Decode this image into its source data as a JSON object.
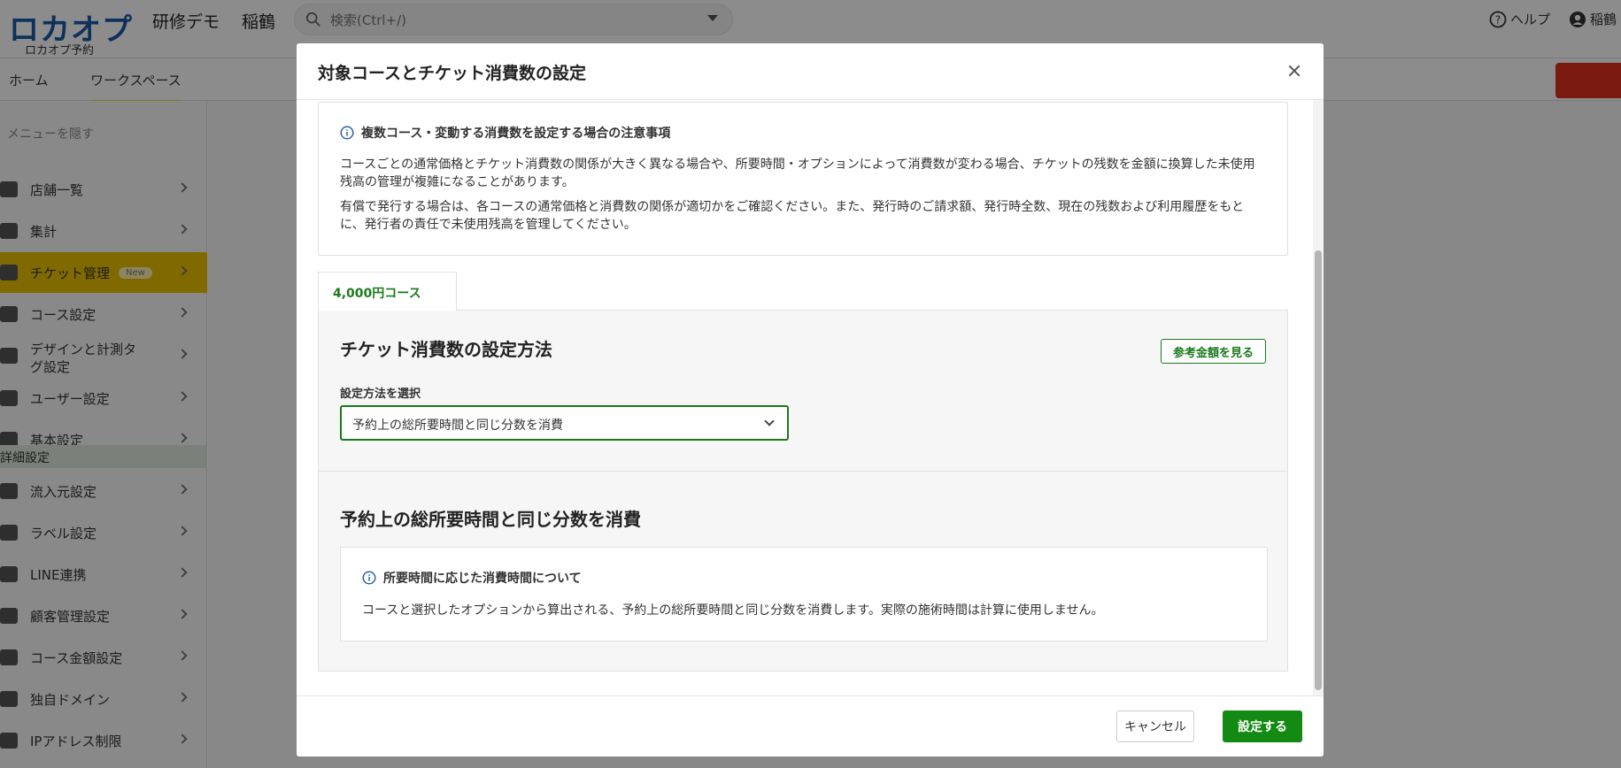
{
  "app": {
    "logo_text": "ロカオプ",
    "logo_sub": "ロカオプ予約",
    "org_name": "研修デモ",
    "user_short": "稲鶴",
    "search_placeholder": "検索(Ctrl+/)",
    "help_label": "ヘルプ",
    "account_label": "稲鶴"
  },
  "nav": {
    "items": [
      {
        "label": "ホーム"
      },
      {
        "label": "ワークスペース"
      }
    ]
  },
  "sidebar": {
    "hide_label": "メニューを隠す",
    "items": [
      {
        "label": "店舗一覧"
      },
      {
        "label": "集計"
      },
      {
        "label": "チケット管理",
        "badge": "New"
      },
      {
        "label": "コース設定"
      },
      {
        "label": "デザインと計測タグ設定"
      },
      {
        "label": "ユーザー設定"
      },
      {
        "label": "基本設定"
      },
      {
        "label": "流入元設定"
      },
      {
        "label": "ラベル設定"
      },
      {
        "label": "LINE連携"
      },
      {
        "label": "顧客管理設定"
      },
      {
        "label": "コース金額設定"
      },
      {
        "label": "独自ドメイン"
      },
      {
        "label": "IPアドレス制限"
      }
    ],
    "section_label": "詳細設定"
  },
  "modal": {
    "title": "対象コースとチケット消費数の設定",
    "notice": {
      "title": "複数コース・変動する消費数を設定する場合の注意事項",
      "paragraph1": "コースごとの通常価格とチケット消費数の関係が大きく異なる場合や、所要時間・オプションによって消費数が変わる場合、チケットの残数を金額に換算した未使用残高の管理が複雑になることがあります。",
      "paragraph2": "有償で発行する場合は、各コースの通常価格と消費数の関係が適切かをご確認ください。また、発行時のご請求額、発行時全数、現在の残数および利用履歴をもとに、発行者の責任で未使用残高を管理してください。"
    },
    "tab_label": "4,000円コース",
    "section1": {
      "title": "チケット消費数の設定方法",
      "ref_button": "参考金額を見る",
      "method_label": "設定方法を選択",
      "method_value": "予約上の総所要時間と同じ分数を消費"
    },
    "section2": {
      "title": "予約上の総所要時間と同じ分数を消費",
      "note_title": "所要時間に応じた消費時間について",
      "note_body": "コースと選択したオプションから算出される、予約上の総所要時間と同じ分数を消費します。実際の施術時間は計算に使用しません。"
    },
    "footer": {
      "cancel": "キャンセル",
      "submit": "設定する"
    }
  },
  "colors": {
    "accent_green": "#138a13",
    "sidebar_active": "#e9c200",
    "logo_blue": "#1b5aa6"
  }
}
